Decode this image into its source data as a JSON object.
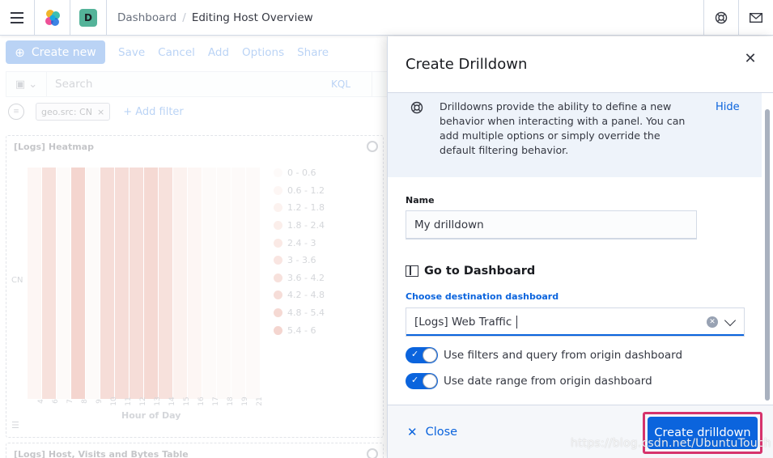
{
  "header": {
    "space_initial": "D",
    "breadcrumbs": [
      "Dashboard",
      "Editing Host Overview"
    ],
    "breadcrumb_separator": "/"
  },
  "toolbar": {
    "create_new": "Create new",
    "save": "Save",
    "cancel": "Cancel",
    "add": "Add",
    "options": "Options",
    "share": "Share"
  },
  "query_bar": {
    "search_placeholder": "Search",
    "kql": "KQL"
  },
  "filters": {
    "pill": "geo.src: CN",
    "add_filter": "+ Add filter"
  },
  "panels": {
    "heatmap_title": "[Logs] Heatmap",
    "table_title": "[Logs] Host, Visits and Bytes Table",
    "y_label": "CN",
    "x_title": "Hour of Day",
    "x_ticks": [
      "4",
      "6",
      "7",
      "8",
      "9",
      "10",
      "11",
      "12",
      "13",
      "14",
      "15",
      "16",
      "17",
      "18",
      "19",
      "21"
    ],
    "legend": [
      "0 - 0.6",
      "0.6 - 1.2",
      "1.2 - 1.8",
      "1.8 - 2.4",
      "2.4 - 3",
      "3 - 3.6",
      "3.6 - 4.2",
      "4.2 - 4.8",
      "4.8 - 5.4",
      "5.4 - 6"
    ],
    "legend_colors": [
      "#fbefec",
      "#f8e0da",
      "#f5d1c8",
      "#f2c3b7",
      "#eeb4a6",
      "#eaa696",
      "#e69786",
      "#e28876",
      "#dd7966",
      "#d86a57"
    ],
    "cell_colors": [
      "#f8e0da",
      "#e69786",
      "#fbefec",
      "#d86a57",
      "#fbefec",
      "#e28876",
      "#e28876",
      "#e28876",
      "#dd7966",
      "#e69786",
      "#f5d1c8",
      "#f8e0da",
      "#fbefec",
      "#fbefec",
      "#fbefec",
      "#fbefec"
    ]
  },
  "flyout": {
    "title": "Create Drilldown",
    "callout_text": "Drilldowns provide the ability to define a new behavior when interacting with a panel. You can add multiple options or simply override the default filtering behavior.",
    "callout_hide": "Hide",
    "name_label": "Name",
    "name_value": "My drilldown",
    "action_title": "Go to Dashboard",
    "dest_label": "Choose destination dashboard",
    "dest_value": "[Logs] Web Traffic",
    "switch_filters": "Use filters and query from origin dashboard",
    "switch_daterange": "Use date range from origin dashboard",
    "close_label": "Close",
    "create_label": "Create drilldown"
  },
  "watermark": "https://blog.csdn.net/UbuntuTouch"
}
